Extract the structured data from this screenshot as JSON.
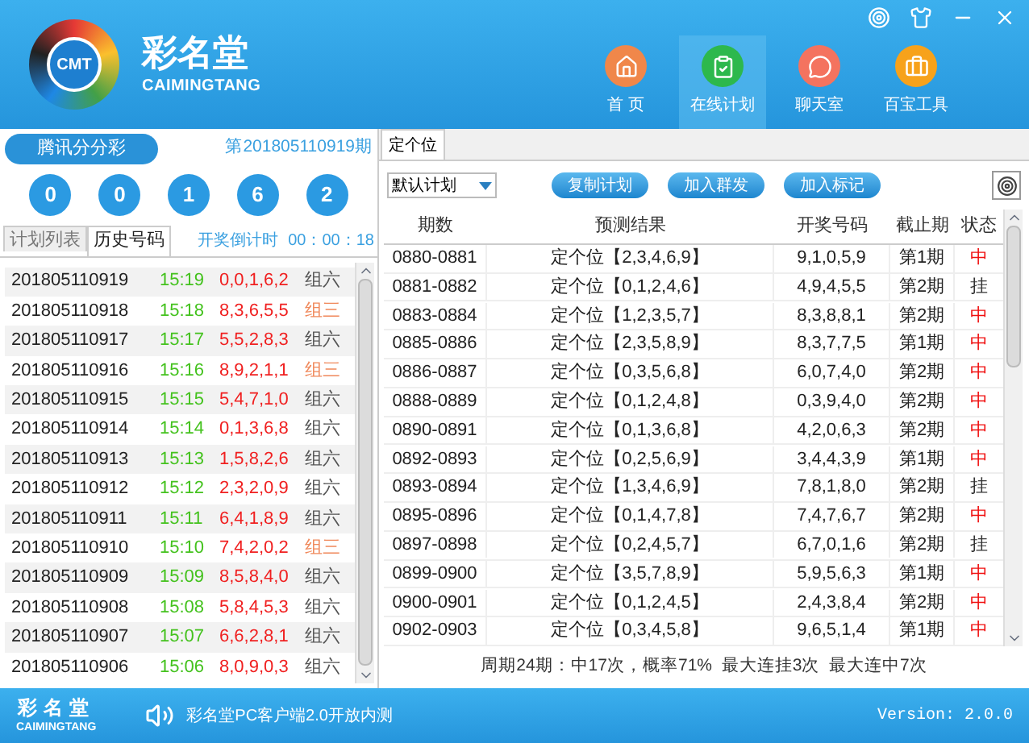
{
  "header": {
    "logo_badge": "CMT",
    "brand": "彩名堂",
    "brand_en": "CAIMINGTANG",
    "nav": [
      {
        "label": "首 页",
        "kind": "home",
        "selected": false
      },
      {
        "label": "在线计划",
        "kind": "plan",
        "selected": true
      },
      {
        "label": "聊天室",
        "kind": "chat",
        "selected": false
      },
      {
        "label": "百宝工具",
        "kind": "tools",
        "selected": false
      }
    ]
  },
  "lottery": {
    "name": "腾讯分分彩",
    "period": "第201805110919期",
    "balls": [
      "0",
      "0",
      "1",
      "6",
      "2"
    ]
  },
  "left_tabs": [
    {
      "label": "计划列表",
      "selected": false
    },
    {
      "label": "历史号码",
      "selected": true
    }
  ],
  "countdown": {
    "label": "开奖倒计时",
    "time": "00：00：18"
  },
  "history": [
    {
      "issue": "201805110919",
      "time": "15:19",
      "numbers": "0,0,1,6,2",
      "group": "组六",
      "color": "#555555"
    },
    {
      "issue": "201805110918",
      "time": "15:18",
      "numbers": "8,3,6,5,5",
      "group": "组三",
      "color": "#f08a5d"
    },
    {
      "issue": "201805110917",
      "time": "15:17",
      "numbers": "5,5,2,8,3",
      "group": "组六",
      "color": "#555555"
    },
    {
      "issue": "201805110916",
      "time": "15:16",
      "numbers": "8,9,2,1,1",
      "group": "组三",
      "color": "#f08a5d"
    },
    {
      "issue": "201805110915",
      "time": "15:15",
      "numbers": "5,4,7,1,0",
      "group": "组六",
      "color": "#555555"
    },
    {
      "issue": "201805110914",
      "time": "15:14",
      "numbers": "0,1,3,6,8",
      "group": "组六",
      "color": "#555555"
    },
    {
      "issue": "201805110913",
      "time": "15:13",
      "numbers": "1,5,8,2,6",
      "group": "组六",
      "color": "#555555"
    },
    {
      "issue": "201805110912",
      "time": "15:12",
      "numbers": "2,3,2,0,9",
      "group": "组六",
      "color": "#555555"
    },
    {
      "issue": "201805110911",
      "time": "15:11",
      "numbers": "6,4,1,8,9",
      "group": "组六",
      "color": "#555555"
    },
    {
      "issue": "201805110910",
      "time": "15:10",
      "numbers": "7,4,2,0,2",
      "group": "组三",
      "color": "#f08a5d"
    },
    {
      "issue": "201805110909",
      "time": "15:09",
      "numbers": "8,5,8,4,0",
      "group": "组六",
      "color": "#555555"
    },
    {
      "issue": "201805110908",
      "time": "15:08",
      "numbers": "5,8,4,5,3",
      "group": "组六",
      "color": "#555555"
    },
    {
      "issue": "201805110907",
      "time": "15:07",
      "numbers": "6,6,2,8,1",
      "group": "组六",
      "color": "#555555"
    },
    {
      "issue": "201805110906",
      "time": "15:06",
      "numbers": "8,0,9,0,3",
      "group": "组六",
      "color": "#555555"
    }
  ],
  "right_tab": "定个位",
  "plan_select": "默认计划",
  "buttons": [
    "复制计划",
    "加入群发",
    "加入标记"
  ],
  "table": {
    "columns": [
      "期数",
      "预测结果",
      "开奖号码",
      "截止期",
      "状态"
    ],
    "rows": [
      {
        "range": "0880-0881",
        "prediction": "定个位【2,3,4,6,9】",
        "draw": "9,1,0,5,9",
        "stop": "第1期",
        "status": "中",
        "hit": true
      },
      {
        "range": "0881-0882",
        "prediction": "定个位【0,1,2,4,6】",
        "draw": "4,9,4,5,5",
        "stop": "第2期",
        "status": "挂",
        "hit": false
      },
      {
        "range": "0883-0884",
        "prediction": "定个位【1,2,3,5,7】",
        "draw": "8,3,8,8,1",
        "stop": "第2期",
        "status": "中",
        "hit": true
      },
      {
        "range": "0885-0886",
        "prediction": "定个位【2,3,5,8,9】",
        "draw": "8,3,7,7,5",
        "stop": "第1期",
        "status": "中",
        "hit": true
      },
      {
        "range": "0886-0887",
        "prediction": "定个位【0,3,5,6,8】",
        "draw": "6,0,7,4,0",
        "stop": "第2期",
        "status": "中",
        "hit": true
      },
      {
        "range": "0888-0889",
        "prediction": "定个位【0,1,2,4,8】",
        "draw": "0,3,9,4,0",
        "stop": "第2期",
        "status": "中",
        "hit": true
      },
      {
        "range": "0890-0891",
        "prediction": "定个位【0,1,3,6,8】",
        "draw": "4,2,0,6,3",
        "stop": "第2期",
        "status": "中",
        "hit": true
      },
      {
        "range": "0892-0893",
        "prediction": "定个位【0,2,5,6,9】",
        "draw": "3,4,4,3,9",
        "stop": "第1期",
        "status": "中",
        "hit": true
      },
      {
        "range": "0893-0894",
        "prediction": "定个位【1,3,4,6,9】",
        "draw": "7,8,1,8,0",
        "stop": "第2期",
        "status": "挂",
        "hit": false
      },
      {
        "range": "0895-0896",
        "prediction": "定个位【0,1,4,7,8】",
        "draw": "7,4,7,6,7",
        "stop": "第2期",
        "status": "中",
        "hit": true
      },
      {
        "range": "0897-0898",
        "prediction": "定个位【0,2,4,5,7】",
        "draw": "6,7,0,1,6",
        "stop": "第2期",
        "status": "挂",
        "hit": false
      },
      {
        "range": "0899-0900",
        "prediction": "定个位【3,5,7,8,9】",
        "draw": "5,9,5,6,3",
        "stop": "第1期",
        "status": "中",
        "hit": true
      },
      {
        "range": "0900-0901",
        "prediction": "定个位【0,1,2,4,5】",
        "draw": "2,4,3,8,4",
        "stop": "第2期",
        "status": "中",
        "hit": true
      },
      {
        "range": "0902-0903",
        "prediction": "定个位【0,3,4,5,8】",
        "draw": "9,6,5,1,4",
        "stop": "第1期",
        "status": "中",
        "hit": true
      }
    ]
  },
  "summary": "周期24期：中17次，概率71%  最大连挂3次  最大连中7次",
  "footer": {
    "brand": "彩名堂",
    "brand_en": "CAIMINGTANG",
    "notice": "彩名堂PC客户端2.0开放内测",
    "version": "Version: 2.0.0"
  }
}
